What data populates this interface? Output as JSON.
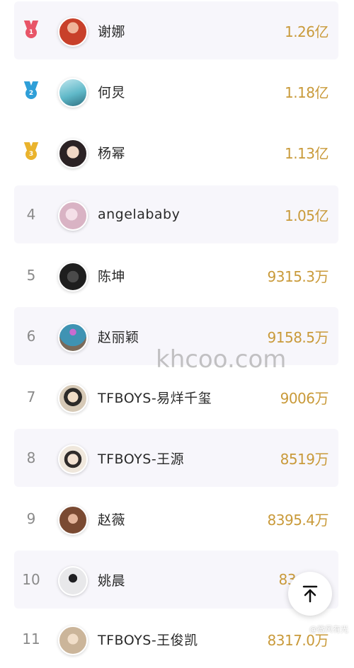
{
  "ranking": {
    "rows": [
      {
        "rank": "1",
        "name": "谢娜",
        "value": "1.26亿",
        "medal": "red",
        "avatar_color": "#c8402a"
      },
      {
        "rank": "2",
        "name": "何炅",
        "value": "1.18亿",
        "medal": "blue",
        "avatar_color": "#5fb8c8"
      },
      {
        "rank": "3",
        "name": "杨幂",
        "value": "1.13亿",
        "medal": "gold",
        "avatar_color": "#e9dad0"
      },
      {
        "rank": "4",
        "name": "angelababy",
        "value": "1.05亿",
        "avatar_color": "#d9b3c4"
      },
      {
        "rank": "5",
        "name": "陈坤",
        "value": "9315.3万",
        "avatar_color": "#2a2a2a"
      },
      {
        "rank": "6",
        "name": "赵丽颖",
        "value": "9158.5万",
        "avatar_color": "#3f93b3"
      },
      {
        "rank": "7",
        "name": "TFBOYS-易烊千玺",
        "value": "9006万",
        "avatar_color": "#d6c9b6"
      },
      {
        "rank": "8",
        "name": "TFBOYS-王源",
        "value": "8519万",
        "avatar_color": "#efe7dc"
      },
      {
        "rank": "9",
        "name": "赵薇",
        "value": "8395.4万",
        "avatar_color": "#7a4a32"
      },
      {
        "rank": "10",
        "name": "姚晨",
        "value": "83",
        "avatar_color": "#e8e8ea"
      },
      {
        "rank": "11",
        "name": "TFBOYS-王俊凯",
        "value": "8317.0万",
        "avatar_color": "#cbb59a"
      }
    ],
    "medal_colors": {
      "red": "#e85568",
      "blue": "#2f9fd8",
      "gold": "#eab32d"
    },
    "value_color": "#c99a3a"
  },
  "watermark": "khcoo.com",
  "credit": "@微风有光",
  "back_to_top": {
    "icon": "arrow-up-icon"
  }
}
